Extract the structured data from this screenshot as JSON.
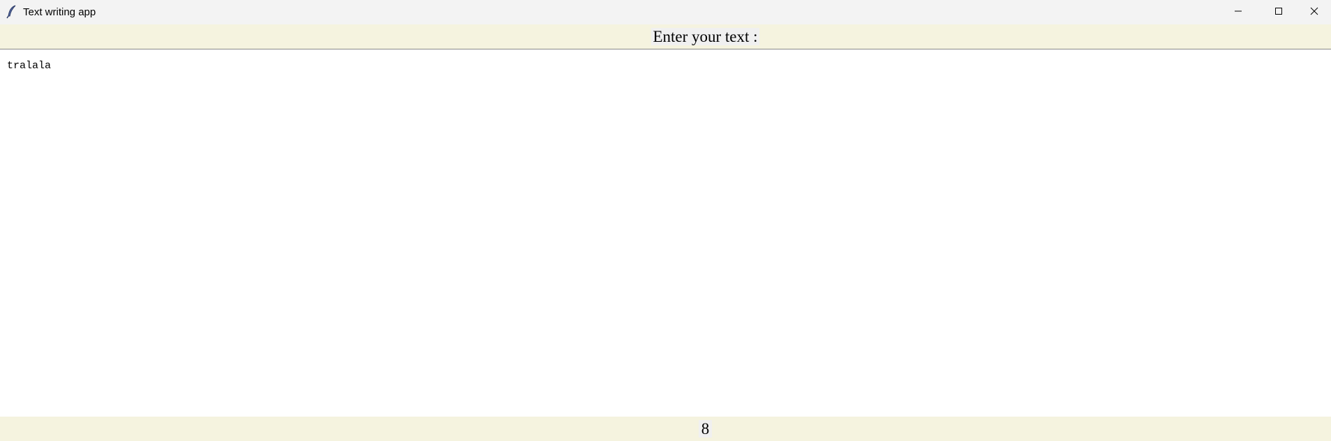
{
  "window": {
    "title": "Text writing app",
    "icon": "feather-icon",
    "controls": [
      "minimize-icon",
      "maximize-icon",
      "close-icon"
    ]
  },
  "header": {
    "label": "Enter your text :"
  },
  "editor": {
    "value": "tralala"
  },
  "status": {
    "char_count": "8"
  },
  "colors": {
    "titlebar_bg": "#f3f3f3",
    "bar_bg": "#f5f3df",
    "label_bg": "#f0f0f0",
    "editor_bg": "#ffffff"
  }
}
